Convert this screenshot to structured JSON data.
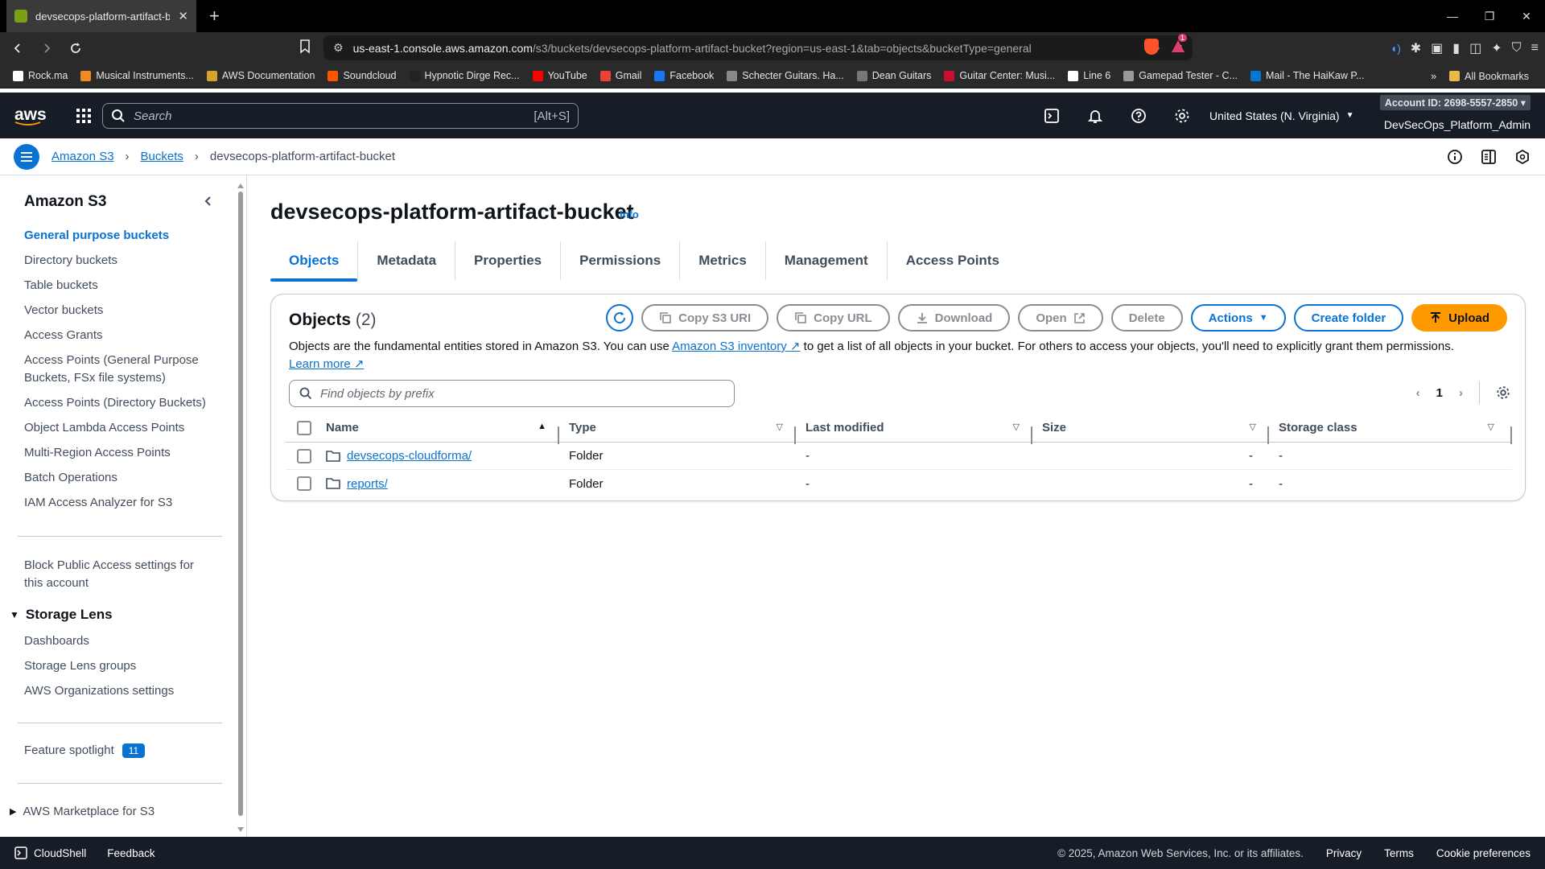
{
  "browser": {
    "tab_title": "devsecops-platform-artifact-buc",
    "url_host": "us-east-1.console.aws.amazon.com",
    "url_path": "/s3/buckets/devsecops-platform-artifact-bucket?region=us-east-1&tab=objects&bucketType=general",
    "bookmarks": [
      {
        "label": "Rock.ma",
        "color": "#ffffff"
      },
      {
        "label": "Musical Instruments...",
        "color": "#f08a24"
      },
      {
        "label": "AWS Documentation",
        "color": "#d6a22b"
      },
      {
        "label": "Soundcloud",
        "color": "#ff5500"
      },
      {
        "label": "Hypnotic Dirge Rec...",
        "color": "#222222"
      },
      {
        "label": "YouTube",
        "color": "#ff0000"
      },
      {
        "label": "Gmail",
        "color": "#ea4335"
      },
      {
        "label": "Facebook",
        "color": "#1877f2"
      },
      {
        "label": "Schecter Guitars. Ha...",
        "color": "#888888"
      },
      {
        "label": "Dean Guitars",
        "color": "#777777"
      },
      {
        "label": "Guitar Center: Musi...",
        "color": "#c8102e"
      },
      {
        "label": "Line 6",
        "color": "#ffffff"
      },
      {
        "label": "Gamepad Tester - C...",
        "color": "#999999"
      },
      {
        "label": "Mail - The HaiKaw P...",
        "color": "#0078d4"
      }
    ],
    "all_bookmarks": "All Bookmarks",
    "badge_count": "1"
  },
  "aws_nav": {
    "logo": "aws",
    "search_placeholder": "Search",
    "search_shortcut": "[Alt+S]",
    "region": "United States (N. Virginia)",
    "account": "Account ID: 2698-5557-2850",
    "user": "DevSecOps_Platform_Admin"
  },
  "breadcrumb": {
    "items": [
      "Amazon S3",
      "Buckets"
    ],
    "current": "devsecops-platform-artifact-bucket"
  },
  "sidebar": {
    "title": "Amazon S3",
    "items": [
      "General purpose buckets",
      "Directory buckets",
      "Table buckets",
      "Vector buckets",
      "Access Grants",
      "Access Points (General Purpose Buckets, FSx file systems)",
      "Access Points (Directory Buckets)",
      "Object Lambda Access Points",
      "Multi-Region Access Points",
      "Batch Operations",
      "IAM Access Analyzer for S3"
    ],
    "block_public": "Block Public Access settings for this account",
    "storage_lens": {
      "title": "Storage Lens",
      "items": [
        "Dashboards",
        "Storage Lens groups",
        "AWS Organizations settings"
      ]
    },
    "feature_spotlight": "Feature spotlight",
    "feature_count": "11",
    "marketplace": "AWS Marketplace for S3"
  },
  "main": {
    "bucket_name": "devsecops-platform-artifact-bucket",
    "info": "Info",
    "tabs": [
      "Objects",
      "Metadata",
      "Properties",
      "Permissions",
      "Metrics",
      "Management",
      "Access Points"
    ],
    "objects": {
      "title": "Objects",
      "count": "(2)",
      "buttons": {
        "copy_s3_uri": "Copy S3 URI",
        "copy_url": "Copy URL",
        "download": "Download",
        "open": "Open",
        "delete": "Delete",
        "actions": "Actions",
        "create_folder": "Create folder",
        "upload": "Upload"
      },
      "desc_1": "Objects are the fundamental entities stored in Amazon S3. You can use",
      "desc_link": "Amazon S3 inventory",
      "desc_2": "to get a list of all objects in your bucket. For others to access your objects, you'll need to explicitly grant them permissions.",
      "learn_more": "Learn more",
      "filter_placeholder": "Find objects by prefix",
      "page": "1",
      "columns": [
        "Name",
        "Type",
        "Last modified",
        "Size",
        "Storage class"
      ],
      "rows": [
        {
          "name": "devsecops-cloudforma/",
          "type": "Folder",
          "modified": "-",
          "size": "-",
          "class": "-"
        },
        {
          "name": "reports/",
          "type": "Folder",
          "modified": "-",
          "size": "-",
          "class": "-"
        }
      ]
    }
  },
  "footer": {
    "cloudshell": "CloudShell",
    "feedback": "Feedback",
    "copyright": "© 2025, Amazon Web Services, Inc. or its affiliates.",
    "privacy": "Privacy",
    "terms": "Terms",
    "cookie": "Cookie preferences"
  }
}
